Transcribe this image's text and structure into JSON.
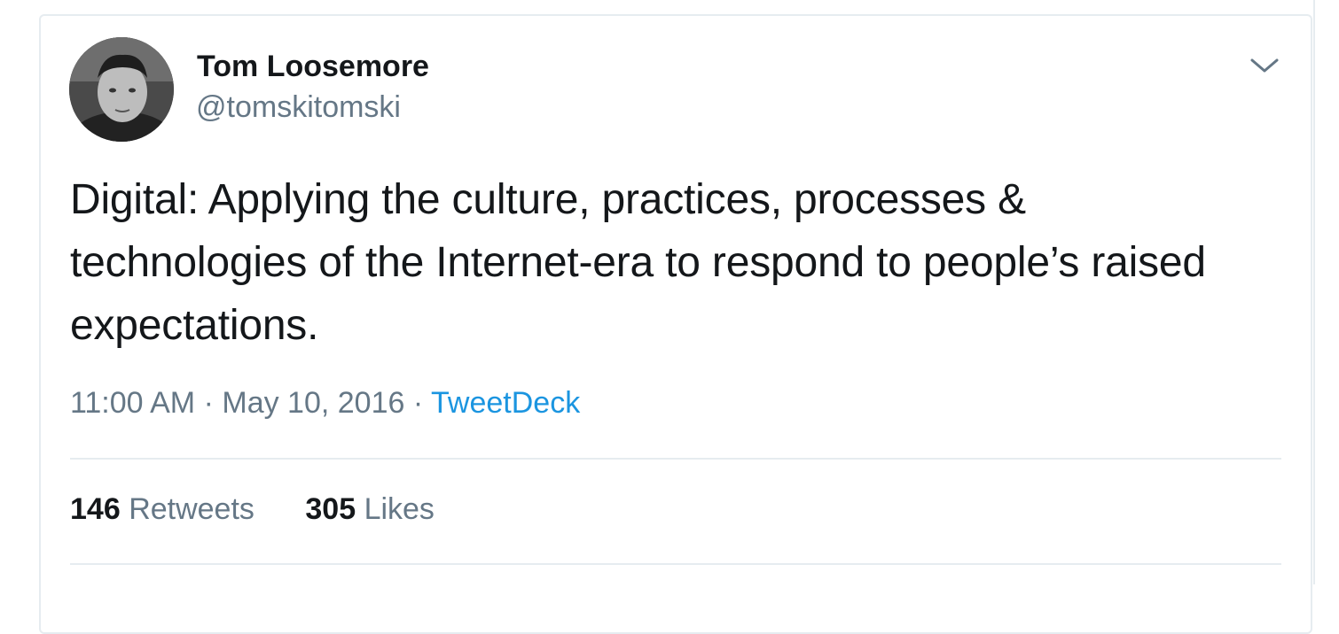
{
  "user": {
    "display_name": "Tom Loosemore",
    "handle": "@tomskitomski"
  },
  "tweet": {
    "text": "Digital: Applying the culture, practices, processes & technologies of the Internet-era to respond to people’s raised expectations.",
    "time": "11:00 AM",
    "separator": "·",
    "date": "May 10, 2016",
    "source": "TweetDeck"
  },
  "stats": {
    "retweets_count": "146",
    "retweets_label": "Retweets",
    "likes_count": "305",
    "likes_label": "Likes"
  },
  "icons": {
    "menu": "chevron-down-icon"
  },
  "colors": {
    "text_primary": "#14171a",
    "text_secondary": "#657786",
    "link": "#1b95e0",
    "border": "#e6ecf0"
  }
}
